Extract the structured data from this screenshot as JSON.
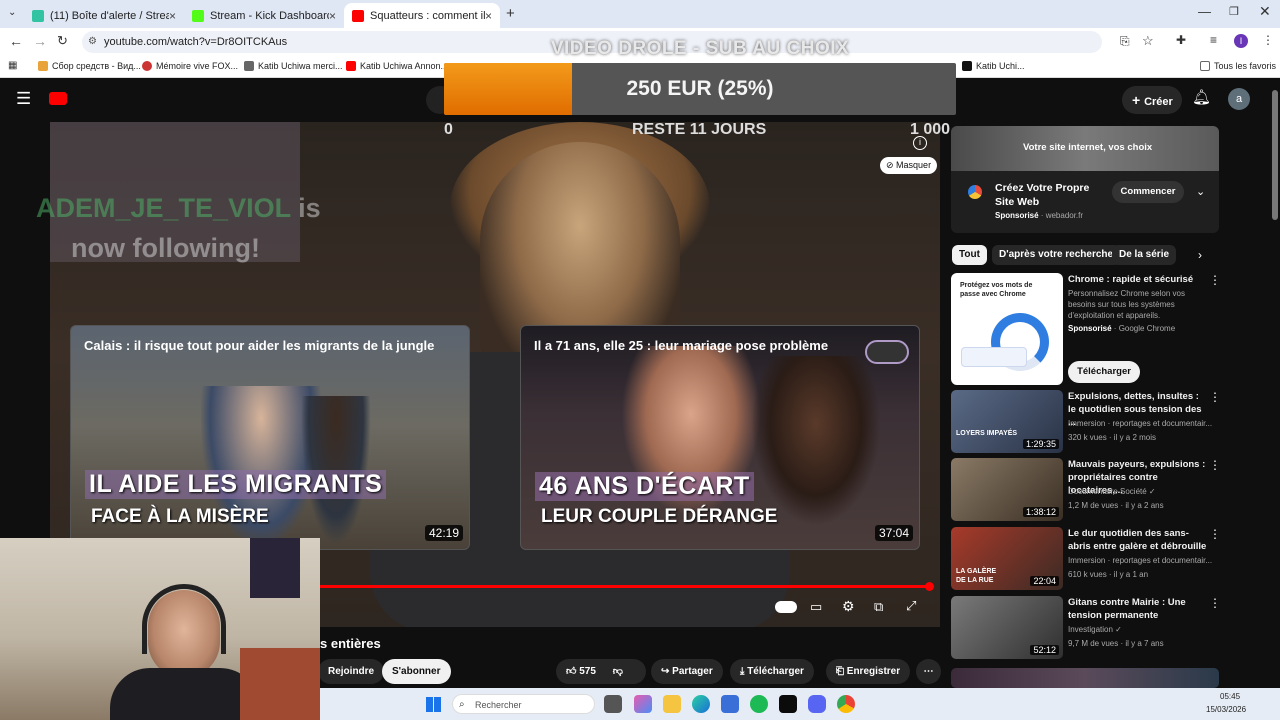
{
  "browser": {
    "tabs": [
      {
        "label": "(11) Boîte d'alerte / Streamlabs",
        "color": "#31c3a2"
      },
      {
        "label": "Stream - Kick Dashboard",
        "color": "#53fc18"
      },
      {
        "label": "Squatteurs : comment ils ruinen",
        "color": "#ff0000"
      }
    ],
    "url": "youtube.com/watch?v=Dr8OITCKAus",
    "bookmarks": [
      "Сбор средств - Вид...",
      "Mémoire vive FOX...",
      "Katib Uchiwa merci...",
      "Katib Uchiwa Annon...",
      "Katib Uchi..."
    ],
    "all_bookmarks": "Tous les favoris",
    "profile_initial": "I"
  },
  "youtube": {
    "create_label": "Créer",
    "avatar_initial": "a",
    "hide_label": "Masquer",
    "title_fragment": "s entières",
    "join_label": "Rejoindre",
    "subscribe_label": "S'abonner",
    "like_count": "575",
    "share_label": "Partager",
    "download_label": "Télécharger",
    "save_label": "Enregistrer",
    "progress": 1.0
  },
  "overlay": {
    "goal_title": "VIDEO DROLE - SUB AU CHOIX",
    "goal_text": "250 EUR (25%)",
    "goal_fraction": 0.25,
    "goal_min": "0",
    "goal_remaining": "RESTE 11 JOURS",
    "goal_max": "1 000",
    "follow_name": "ADEM_JE_TE_VIOL",
    "follow_suffix": "is",
    "follow_line2": "now following!"
  },
  "endcards": [
    {
      "title": "Calais : il risque tout pour aider les migrants de la jungle",
      "big1": "IL AIDE LES MIGRANTS",
      "big2": "FACE À LA MISÈRE",
      "duration": "42:19"
    },
    {
      "title": "Il a 71 ans, elle 25 : leur mariage pose problème",
      "big1": "46 ANS D'ÉCART",
      "big2": "LEUR COUPLE DÉRANGE",
      "duration": "37:04"
    }
  ],
  "sidebar": {
    "ad": {
      "banner": "Votre site internet, vos choix",
      "title": "Créez Votre Propre Site Web",
      "sponsored": "Sponsorisé",
      "domain": "webador.fr",
      "cta": "Commencer"
    },
    "chips": [
      "Tout",
      "D'après votre recherche",
      "De la série"
    ],
    "promo": {
      "thumb_text": "Protégez vos mots de passe avec Chrome",
      "title": "Chrome : rapide et sécurisé",
      "desc": "Personnalisez Chrome selon vos besoins sur tous les systèmes d'exploitation et appareils.",
      "sponsored": "Sponsorisé",
      "advertiser": "Google Chrome",
      "cta": "Télécharger"
    },
    "videos": [
      {
        "title": "Expulsions, dettes, insultes : le quotidien sous tension des ...",
        "channel": "Immersion · reportages et documentair...",
        "meta": "320 k vues · il y a 2 mois",
        "duration": "1:29:35",
        "thumb_text": "LOYERS IMPAYÉS"
      },
      {
        "title": "Mauvais payeurs, expulsions : propriétaires contre locataires,...",
        "channel": "Documentaire Société ✓",
        "meta": "1,2 M de vues · il y a 2 ans",
        "duration": "1:38:12",
        "thumb_text": ""
      },
      {
        "title": "Le dur quotidien des sans-abris entre galère et débrouille",
        "channel": "Immersion · reportages et documentair...",
        "meta": "610 k vues · il y a 1 an",
        "duration": "22:04",
        "thumb_text": "LA GALÈRE DE LA RUE"
      },
      {
        "title": "Gitans contre Mairie : Une tension permanente",
        "channel": "Investigation ✓",
        "meta": "9,7 M de vues · il y a 7 ans",
        "duration": "52:12",
        "thumb_text": ""
      }
    ]
  },
  "taskbar": {
    "search_placeholder": "Rechercher",
    "time": "05:45",
    "date": "15/03/2026"
  }
}
